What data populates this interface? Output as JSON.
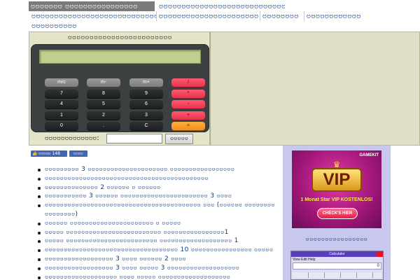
{
  "nav": {
    "items": [
      {
        "label": "ဗဗဗဗဗဗဗ ဗဗဗဗဗဗဗဗဗဗဗဗဗဗဗဗ",
        "active": true
      },
      {
        "label": "ဗဗဗဗဗဗဗဗဗဗဗဗဗဗဗဗဗဗဗဗဗဗဗဗဗဗဗဗဗဗဗဗဗ"
      },
      {
        "label": "ဗဗဗဗဗဗဗဗဗဗဗဗဗဗဗဗဗဗဗဗဗဗဗဗဗဗဗဗဗ"
      },
      {
        "label": "ဗဗဗဗဗဗဗဗဗဗဗဗဗဗဗဗဗဗဗဗဗဗဗဗ"
      },
      {
        "label": "ဗဗဗဗဗဗဗဗ"
      },
      {
        "label": "ဗဗဗဗဗဗဗဗဗဗဗဗ"
      },
      {
        "label": "ဗဗဗဗဗဗဗဗဗဗ"
      }
    ]
  },
  "calculator": {
    "title": "ဗဗဗဗဗဗဗဗဗဗဗဗဗဗဗဗဗဗဗဗဗဗဗဗ",
    "display": "",
    "keys": [
      [
        "mrc",
        "m-",
        "m+",
        "/"
      ],
      [
        "7",
        "8",
        "9",
        "*"
      ],
      [
        "4",
        "5",
        "6",
        "-"
      ],
      [
        "1",
        "2",
        "3",
        "+"
      ],
      [
        "0",
        ".",
        "C",
        "="
      ]
    ],
    "result_label": "ဗဗဗဗဗဗဗဗဗဗဗဗဗ:",
    "result_value": "",
    "result_button": "ဗဗဗဗဗ"
  },
  "social": {
    "like_label": "ဗဗဗဗဗ 148",
    "share_label": "ဗဗဗဗ"
  },
  "articles": [
    "ဗဗဗဗဗဗဗဗဗ 3 ဗဗဗဗဗဗဗဗဗဗဗဗဗဗဗဗဗဗဗဗဗ ဗဗဗဗဗဗဗဗဗဗဗဗဗဗဗဗဗ",
    "ဗဗဗဗဗဗဗဗဗဗဗဗဗဗဗဗဗဗဗဗဗဗဗဗဗဗဗဗဗဗဗဗဗဗဗဗဗဗဗဗဗဗဗ",
    "ဗဗဗဗဗဗဗဗဗဗဗဗဗဗ 2 ဗဗဗဗဗဗ ဗ ဗဗဗဗဗဗ",
    "ဗဗဗဗဗဗဗဗဗဗဗ 3 ဗဗဗဗဗဗ ဗဗဗဗဗဗဗဗဗဗဗဗဗဗဗဗဗဗဗဗဗဗဗ 3 ဗဗဗဗ",
    "ဗဗဗဗဗဗဗဗဗဗဗဗဗဗဗဗဗဗဗဗဗဗဗဗဗဗဗဗဗဗဗဗဗဗဗဗဗဗဗဗဗ ဗဗဗ (ဗဗဗဗဗဗ ဗဗဗဗဗဗဗဗဗဗဗဗဗဗဗဗ)",
    "ဗဗဗဗဗဗ ဗဗဗဗဗဗဗဗဗဗဗဗဗဗဗဗဗဗဗဗဗဗ ဗ ဗဗဗဗဗ",
    "ဗဗဗဗဗ ဗဗဗဗဗဗဗဗဗဗဗဗဗဗဗဗဗဗဗဗဗဗဗဗဗ ဗဗဗဗဗဗဗဗဗဗဗဗဗဗဗဗ1",
    "ဗဗဗဗဗ ဗဗဗဗဗဗဗဗဗဗဗဗဗဗဗဗဗဗဗဗဗဗဗဗ ဗဗဗဗဗဗဗဗဗဗဗဗဗဗဗဗဗဗဗ 1",
    "ဗဗဗဗဗဗဗဗဗဗဗဗဗဗဗဗဗဗဗဗဗဗဗဗဗဗဗဗဗဗဗဗဗဗဗ 10 ဗဗဗဗဗဗဗဗဗဗဗဗဗဗဗဗ ဗဗဗဗဗ",
    "ဗဗဗဗဗဗဗဗဗဗဗဗဗဗဗဗဗဗ 3 ဗဗဗဗ ဗဗဗဗဗဗ 2 ဗဗဗဗ",
    "ဗဗဗဗဗဗဗဗဗဗဗဗဗဗဗဗဗဗ 3 ဗဗဗဗ ဗဗဗဗဗ 3 ဗဗဗဗဗဗဗဗဗဗဗဗဗဗဗဗဗဗဗ",
    "ဗဗဗဗဗဗဗဗဗဗဗဗဗဗဗဗဗဗဗ ဗဗဗဗ ဗဗဗဗဗ ဗဗဗဗဗဗဗဗဗဗဗဗဗဗဗဗဗဗဗ"
  ],
  "sidebar": {
    "ad": {
      "brand": "GAMEKIT",
      "headline": "VIP",
      "text": "1 Monat Star VIP KOSTENLOS!",
      "cta": "CHECK'S HIER"
    },
    "title": "ဗဗဗဗဗဗဗဗဗဗဗဗဗဗဗဗ",
    "thumbnail": {
      "window_title": "Calculator",
      "menu": "View  Edit  Help",
      "display": "0"
    }
  },
  "colors": {
    "link": "#0a3c82",
    "panel": "#e4e4c8",
    "sidebar": "#c8c8ee",
    "op_key": "#ff5a72",
    "eq_key": "#f3901b"
  }
}
